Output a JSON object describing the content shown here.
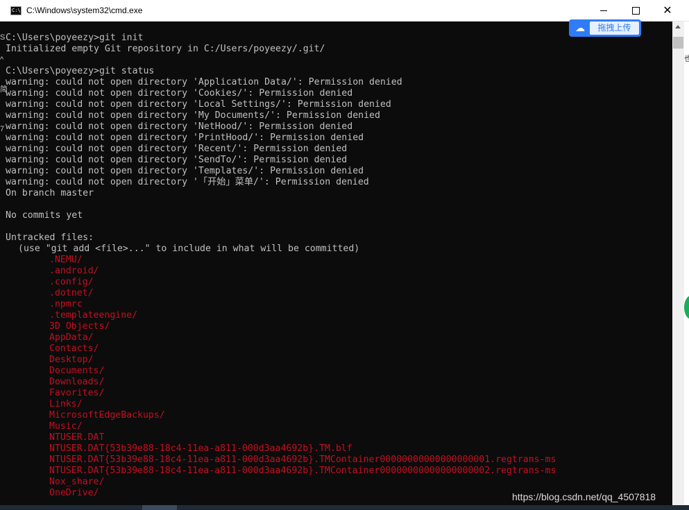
{
  "window": {
    "title": "C:\\Windows\\system32\\cmd.exe",
    "icon": "cmd-icon",
    "icon_label": "C:\\",
    "close_glyph": "✕"
  },
  "upload_button": {
    "label": "拖拽上传",
    "icon": "cloud-upload-icon",
    "icon_glyph": "☁"
  },
  "left_edge_chars": [
    "S",
    "^",
    "简",
    "7"
  ],
  "right_edge_text": "也",
  "console": {
    "lines": [
      "C:\\Users\\poyeezy>git init",
      "Initialized empty Git repository in C:/Users/poyeezy/.git/",
      "",
      "C:\\Users\\poyeezy>git status",
      "warning: could not open directory 'Application Data/': Permission denied",
      "warning: could not open directory 'Cookies/': Permission denied",
      "warning: could not open directory 'Local Settings/': Permission denied",
      "warning: could not open directory 'My Documents/': Permission denied",
      "warning: could not open directory 'NetHood/': Permission denied",
      "warning: could not open directory 'PrintHood/': Permission denied",
      "warning: could not open directory 'Recent/': Permission denied",
      "warning: could not open directory 'SendTo/': Permission denied",
      "warning: could not open directory 'Templates/': Permission denied",
      "warning: could not open directory '「开始」菜单/': Permission denied",
      "On branch master",
      "",
      "No commits yet",
      "",
      "Untracked files:"
    ],
    "hint": "(use \"git add <file>...\" to include in what will be committed)",
    "untracked": [
      ".NEMU/",
      ".android/",
      ".config/",
      ".dotnet/",
      ".npmrc",
      ".templateengine/",
      "3D Objects/",
      "AppData/",
      "Contacts/",
      "Desktop/",
      "Documents/",
      "Downloads/",
      "Favorites/",
      "Links/",
      "MicrosoftEdgeBackups/",
      "Music/",
      "NTUSER.DAT",
      "NTUSER.DAT{53b39e88-18c4-11ea-a811-000d3aa4692b}.TM.blf",
      "NTUSER.DAT{53b39e88-18c4-11ea-a811-000d3aa4692b}.TMContainer00000000000000000001.regtrans-ms",
      "NTUSER.DAT{53b39e88-18c4-11ea-a811-000d3aa4692b}.TMContainer00000000000000000002.regtrans-ms",
      "Nox_share/",
      "OneDrive/"
    ]
  },
  "watermark": "https://blog.csdn.net/qq_4507818",
  "colors": {
    "console_bg": "#0c0c0c",
    "console_text": "#c0c0c0",
    "untracked_text": "#c50f1f",
    "upload_accent": "#2f7cf6"
  }
}
